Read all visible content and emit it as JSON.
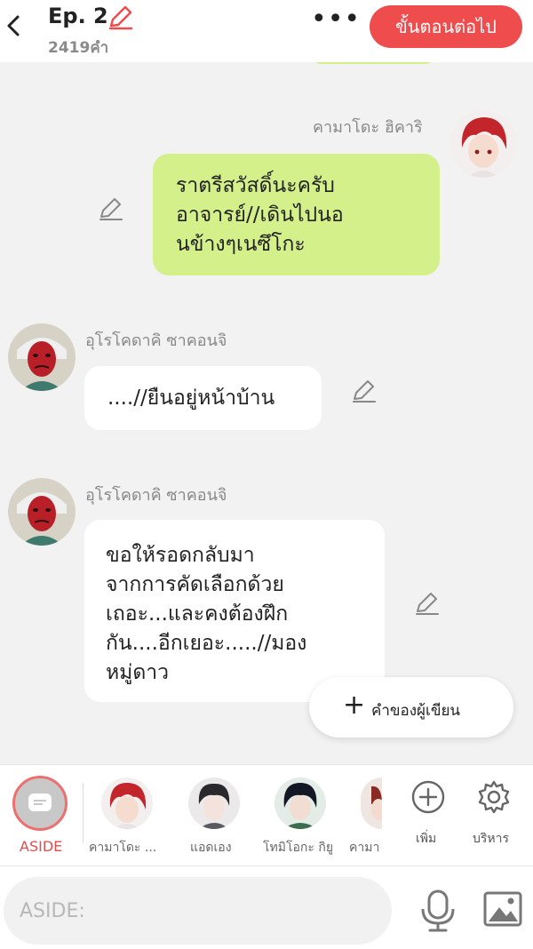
{
  "header": {
    "episode": "Ep. 2",
    "word_count": "2419คำ",
    "more": "•••",
    "next_label": "ขั้นตอนต่อไป"
  },
  "messages": [
    {
      "side": "right",
      "name": "คามาโดะ ฮิคาริ",
      "lines": [
        "ราตรีสวัสดิ์นะครับ",
        "อาจารย์//เดินไปนอ",
        "นข้างๆเนซึโกะ"
      ]
    },
    {
      "side": "left",
      "name": "อุโรโคดาคิ ซาคอนจิ",
      "lines": [
        "....//ยืนอยู่หน้าบ้าน"
      ]
    },
    {
      "side": "left",
      "name": "อุโรโคดาคิ ซาคอนจิ",
      "lines": [
        "ขอให้รอดกลับมา",
        "จากการคัดเลือกด้วย",
        "เถอะ...และคงต้องฝึก",
        "กัน....อีกเยอะ.....//มอง",
        "หมู่ดาว"
      ]
    }
  ],
  "writer_button": "คำของผู้เขียน",
  "characters": {
    "aside_label": "ASIDE",
    "items": [
      {
        "name": "คามาโดะ ..."
      },
      {
        "name": "แอดเอง"
      },
      {
        "name": "โทมิโอกะ กิยู"
      },
      {
        "name": "คามา"
      }
    ],
    "add_label": "เพิ่ม",
    "manage_label": "บริหาร"
  },
  "input": {
    "placeholder": "ASIDE:"
  },
  "colors": {
    "accent": "#ef4c4e",
    "bubble_green": "#d4f08a",
    "background": "#f2f2f2"
  }
}
